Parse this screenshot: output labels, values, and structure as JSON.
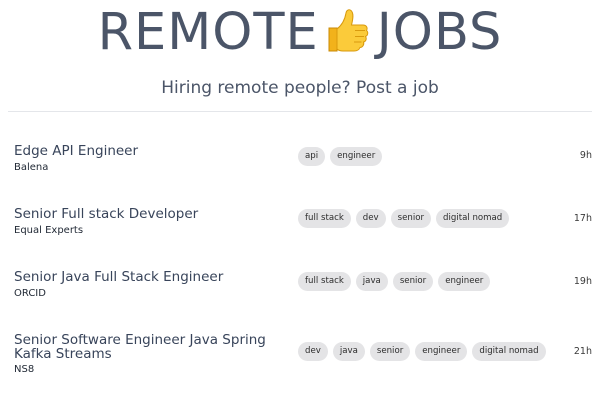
{
  "header": {
    "title_left": "REMOTE",
    "title_right": "JOBS",
    "title_icon": "thumbs-up",
    "tagline_prefix": "Hiring remote people? ",
    "tagline_link": "Post a job"
  },
  "jobs": [
    {
      "title": "Edge API Engineer",
      "company": "Balena",
      "tags": [
        "api",
        "engineer"
      ],
      "age": "9h"
    },
    {
      "title": "Senior Full stack Developer",
      "company": "Equal Experts",
      "tags": [
        "full stack",
        "dev",
        "senior",
        "digital nomad"
      ],
      "age": "17h"
    },
    {
      "title": "Senior Java Full Stack Engineer",
      "company": "ORCID",
      "tags": [
        "full stack",
        "java",
        "senior",
        "engineer"
      ],
      "age": "19h"
    },
    {
      "title": "Senior Software Engineer Java Spring Kafka Streams",
      "company": "NS8",
      "tags": [
        "dev",
        "java",
        "senior",
        "engineer",
        "digital nomad"
      ],
      "age": "21h"
    }
  ],
  "colors": {
    "text": "#4b5568",
    "tag_bg": "#e4e4e6",
    "divider": "#e4e6ea",
    "thumb": "#f7c12e"
  }
}
